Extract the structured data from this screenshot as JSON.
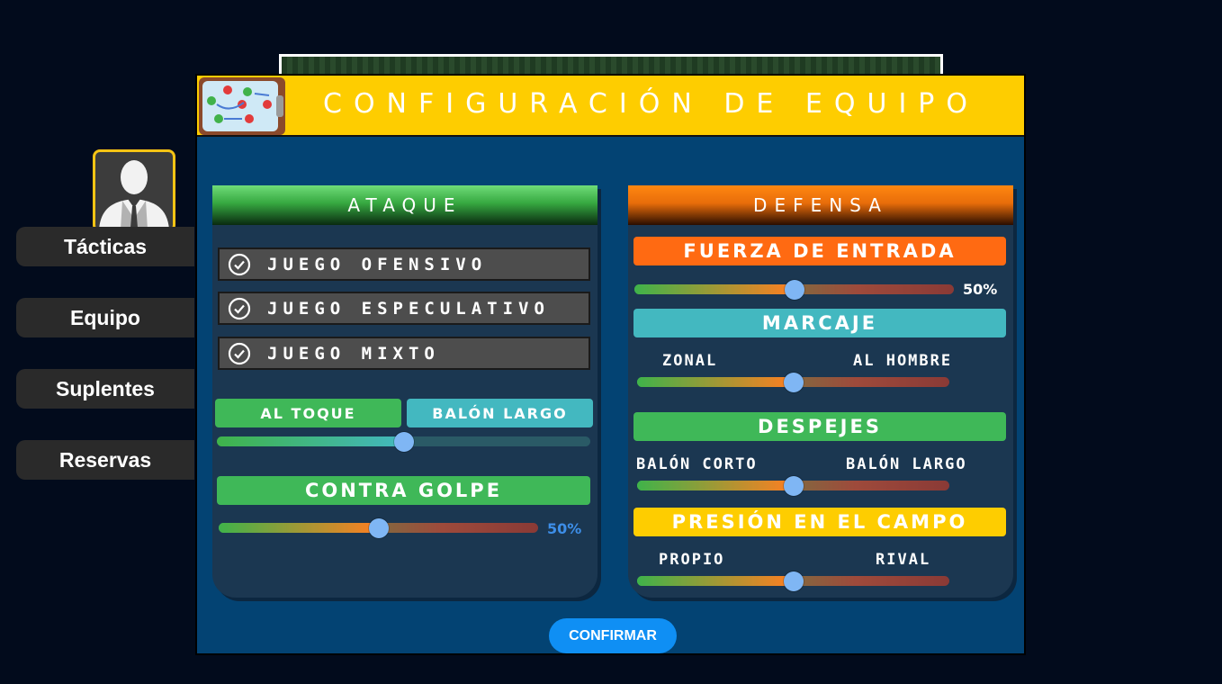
{
  "header": {
    "title": "CONFIGURACIÓN DE EQUIPO",
    "icon": "tactics-board-icon"
  },
  "sidebar": {
    "avatar_icon": "user-silhouette-icon",
    "items": [
      {
        "label": "Tácticas"
      },
      {
        "label": "Equipo"
      },
      {
        "label": "Suplentes"
      },
      {
        "label": "Reservas"
      }
    ]
  },
  "attack": {
    "title": "ATAQUE",
    "options": [
      "JUEGO OFENSIVO",
      "JUEGO ESPECULATIVO",
      "JUEGO MIXTO"
    ],
    "passing": {
      "left_label": "AL TOQUE",
      "right_label": "BALÓN LARGO",
      "value": 0.5
    },
    "counter": {
      "label": "CONTRA GOLPE",
      "value": 0.5,
      "value_text": "50%"
    }
  },
  "defense": {
    "title": "DEFENSA",
    "tackle": {
      "label": "FUERZA DE ENTRADA",
      "value": 0.5,
      "value_text": "50%"
    },
    "marking": {
      "label": "MARCAJE",
      "left": "ZONAL",
      "right": "AL HOMBRE",
      "value": 0.5
    },
    "clearances": {
      "label": "DESPEJES",
      "left": "BALÓN CORTO",
      "right": "BALÓN LARGO",
      "value": 0.5
    },
    "pressure": {
      "label": "PRESIÓN EN EL CAMPO",
      "left": "PROPIO",
      "right": "RIVAL",
      "value": 0.5
    }
  },
  "confirm_label": "CONFIRMAR",
  "colors": {
    "header": "#fecd00",
    "panel": "#034373",
    "green": "#3fb858",
    "teal": "#43b8c0",
    "orange": "#ff6a12",
    "yellow": "#fecd00",
    "knob": "#7fb6f4",
    "confirm": "#0f8ff4"
  }
}
